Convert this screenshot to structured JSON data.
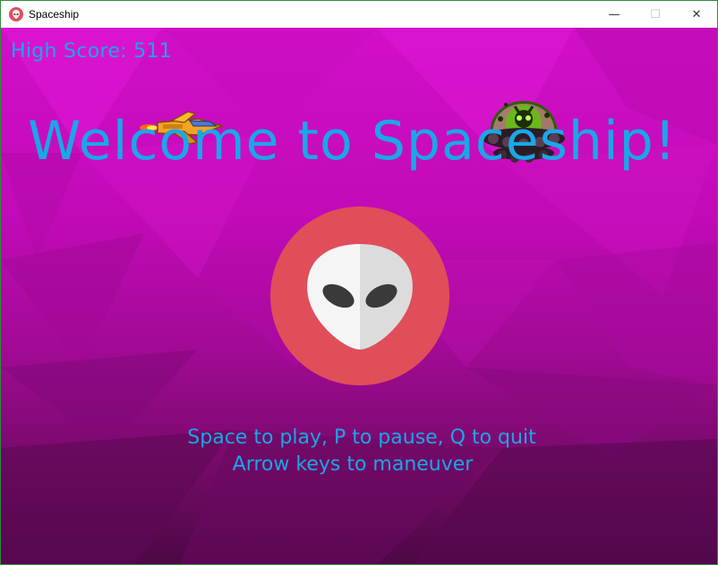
{
  "window": {
    "title": "Spaceship",
    "controls": {
      "minimize": "—",
      "maximize": "☐",
      "close": "✕"
    }
  },
  "game": {
    "high_score_label": "High Score: 511",
    "welcome_title": "Welcome to Spaceship!",
    "instructions": [
      "Space to play, P to pause, Q to quit",
      "Arrow keys to maneuver"
    ]
  },
  "colors": {
    "text_accent": "#1aa7e8",
    "background_top": "#d10fc8",
    "background_bottom": "#4c0844",
    "logo_circle": "#e04e5a"
  },
  "icons": {
    "app": "alien-head-icon",
    "ship": "player-spaceship",
    "enemy": "alien-ufo",
    "logo": "alien-logo"
  }
}
